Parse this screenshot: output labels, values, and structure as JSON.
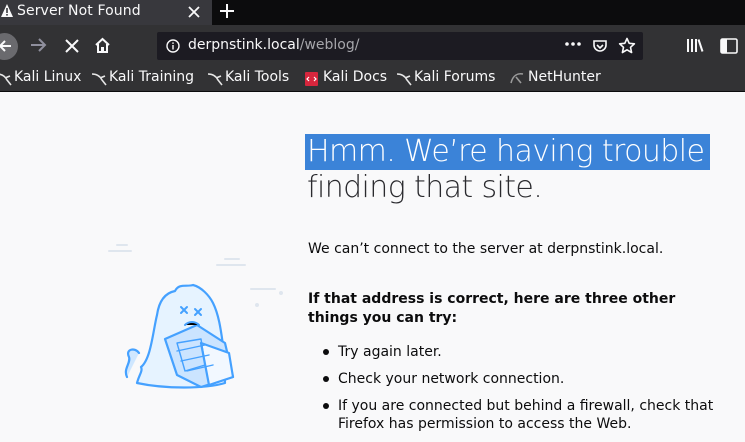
{
  "tab": {
    "title": "Server Not Found"
  },
  "urlbar": {
    "host": "derpnstink.local",
    "path": "/weblog/"
  },
  "bookmarks": [
    {
      "label": "Kali Linux",
      "icon": "kali-dragon-icon"
    },
    {
      "label": "Kali Training",
      "icon": "kali-dragon-icon"
    },
    {
      "label": "Kali Tools",
      "icon": "kali-dragon-icon"
    },
    {
      "label": "Kali Docs",
      "icon": "kali-docs-icon"
    },
    {
      "label": "Kali Forums",
      "icon": "kali-dragon-icon"
    },
    {
      "label": "NetHunter",
      "icon": "nethunter-icon"
    }
  ],
  "error": {
    "title_line1": "Hmm. We’re having trouble",
    "title_line2": "finding that site.",
    "message": "We can’t connect to the server at derpnstink.local.",
    "heading": "If that address is correct, here are three other things you can try:",
    "tips": [
      "Try again later.",
      "Check your network connection.",
      "If you are connected but behind a firewall, check that Firefox has permission to access the Web."
    ]
  },
  "colors": {
    "tabbar": "#0c0c0d",
    "toolbar": "#323234",
    "urlbar": "#1c1b22",
    "page": "#f9f9fa",
    "selection": "#3b83d8",
    "illustration": "#45a1ff"
  }
}
